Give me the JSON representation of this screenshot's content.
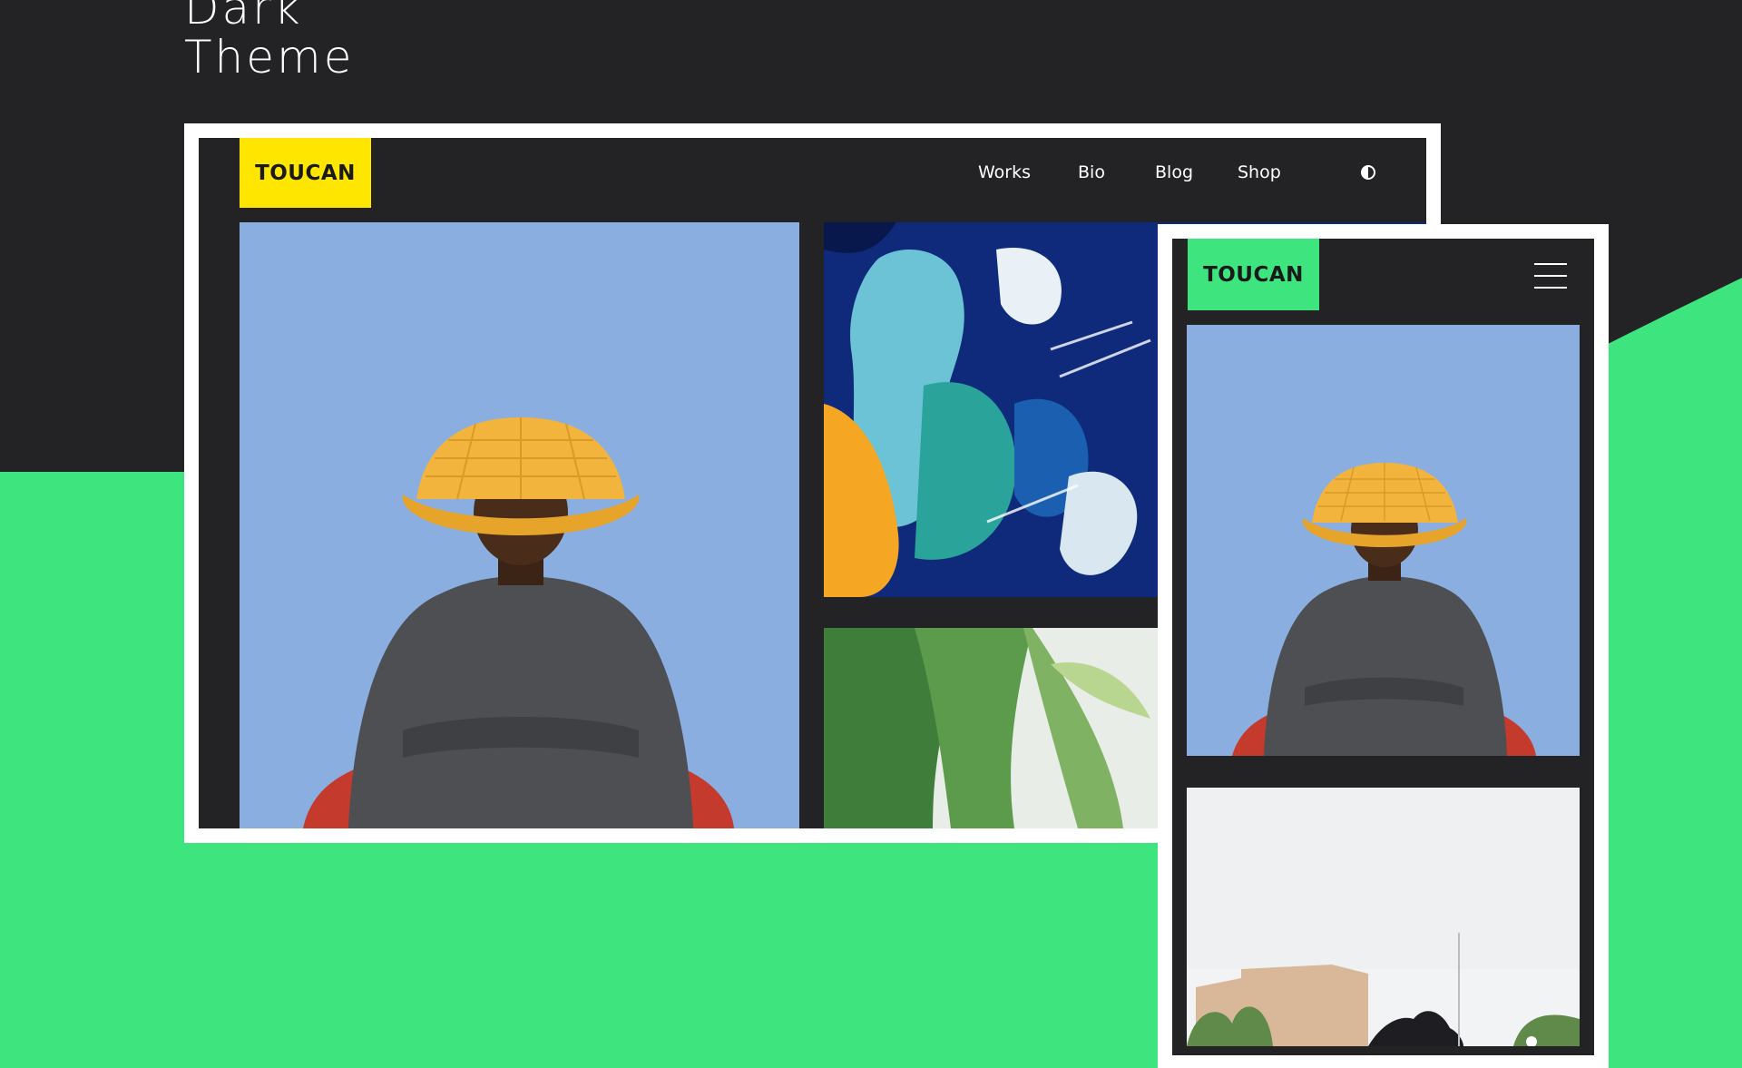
{
  "headline": {
    "line1": "Dark",
    "line2": "Theme"
  },
  "colors": {
    "accent_green": "#3ee47e",
    "dark_background": "#232326",
    "logo_yellow": "#ffe600",
    "photo_blue": "#8aaee0",
    "frame_white": "#ffffff"
  },
  "desktop": {
    "logo": "TOUCAN",
    "nav": [
      {
        "label": "Works"
      },
      {
        "label": "Bio"
      },
      {
        "label": "Blog"
      },
      {
        "label": "Shop"
      }
    ],
    "theme_toggle_icon": "half-circle-contrast-icon",
    "images": [
      "person-with-basket-hat-photo",
      "abstract-paint-art-photo",
      "green-leaf-closeup-photo"
    ]
  },
  "mobile": {
    "logo": "TOUCAN",
    "menu_icon": "hamburger-menu-icon",
    "images": [
      "person-with-basket-hat-photo",
      "sky-buildings-photo"
    ]
  }
}
